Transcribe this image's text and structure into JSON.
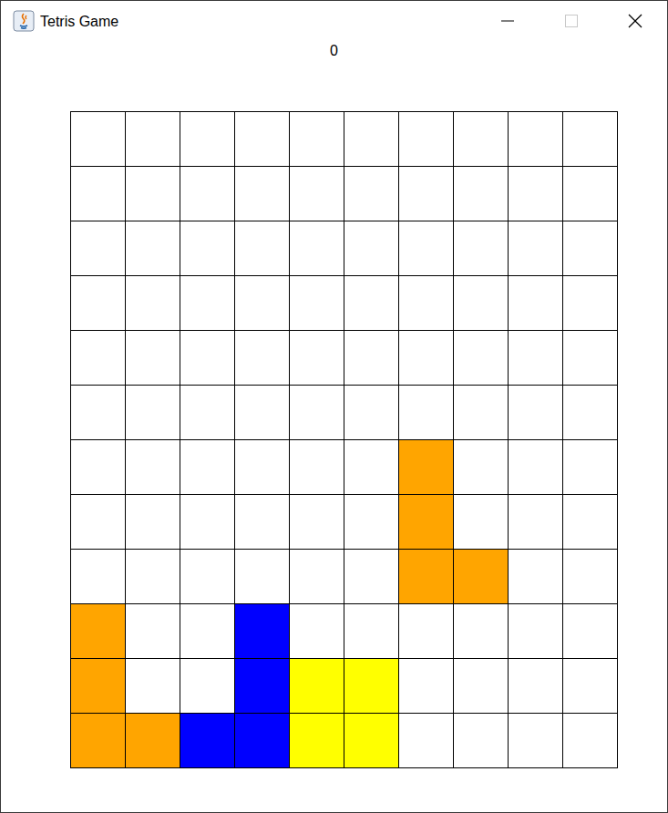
{
  "window": {
    "title": "Tetris Game"
  },
  "score": "0",
  "board": {
    "rows": [
      [
        null,
        null,
        null,
        null,
        null,
        null,
        null,
        null,
        null,
        null
      ],
      [
        null,
        null,
        null,
        null,
        null,
        null,
        null,
        null,
        null,
        null
      ],
      [
        null,
        null,
        null,
        null,
        null,
        null,
        null,
        null,
        null,
        null
      ],
      [
        null,
        null,
        null,
        null,
        null,
        null,
        null,
        null,
        null,
        null
      ],
      [
        null,
        null,
        null,
        null,
        null,
        null,
        null,
        null,
        null,
        null
      ],
      [
        null,
        null,
        null,
        null,
        null,
        null,
        null,
        null,
        null,
        null
      ],
      [
        null,
        null,
        null,
        null,
        null,
        null,
        "#ffa500",
        null,
        null,
        null
      ],
      [
        null,
        null,
        null,
        null,
        null,
        null,
        "#ffa500",
        null,
        null,
        null
      ],
      [
        null,
        null,
        null,
        null,
        null,
        null,
        "#ffa500",
        "#ffa500",
        null,
        null
      ],
      [
        "#ffa500",
        null,
        null,
        "#0000ff",
        null,
        null,
        null,
        null,
        null,
        null
      ],
      [
        "#ffa500",
        null,
        null,
        "#0000ff",
        "#ffff00",
        "#ffff00",
        null,
        null,
        null,
        null
      ],
      [
        "#ffa500",
        "#ffa500",
        "#0000ff",
        "#0000ff",
        "#ffff00",
        "#ffff00",
        null,
        null,
        null,
        null
      ]
    ]
  }
}
